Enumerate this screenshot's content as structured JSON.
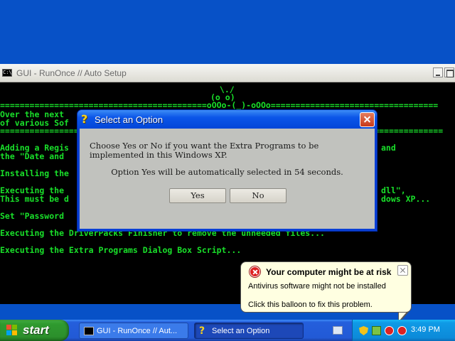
{
  "console": {
    "title": "GUI - RunOnce // Auto Setup",
    "icon": "console-icon",
    "lines": {
      "art1": " \\./ ",
      "art2": "(o o)",
      "sep1": "==========================================oOOo-(_)-oOOo==================================",
      "l_over": "Over the next",
      "l_of": "of various Sof",
      "sep2": "==========================================================================================",
      "l_adding": "Adding a Regis",
      "l_adding_end": "and",
      "l_date": "the \"Date and",
      "l_installing": "Installing the",
      "l_exec1": "Executing the",
      "l_exec1_end": "dll\",",
      "l_must": "This must be d",
      "l_must_end": "dows XP...",
      "l_set": "Set \"Password",
      "l_exec2": "Executing the DriverPacks Finisher to remove the unneeded files...",
      "l_exec3": "Executing the Extra Programs Dialog Box Script..."
    }
  },
  "dialog": {
    "title": "Select an Option",
    "icon": "help-icon",
    "message1": "Choose Yes or No if you want the Extra Programs to be implemented in this Windows XP.",
    "message2": "Option Yes will be automatically selected in 54 seconds.",
    "yes_label": "Yes",
    "no_label": "No"
  },
  "balloon": {
    "title": "Your computer might be at risk",
    "text1": "Antivirus software might not be installed",
    "text2": "Click this balloon to fix this problem.",
    "icon": "security-warning-icon"
  },
  "taskbar": {
    "start_label": "start",
    "tasks": [
      {
        "label": "GUI - RunOnce // Aut...",
        "icon": "console-icon"
      },
      {
        "label": "Select an Option",
        "icon": "help-icon"
      }
    ],
    "clock": "3:49 PM"
  },
  "colors": {
    "console_text": "#19e02a",
    "desktop": "#0751c7",
    "dialog_title": "#0b55e8"
  }
}
